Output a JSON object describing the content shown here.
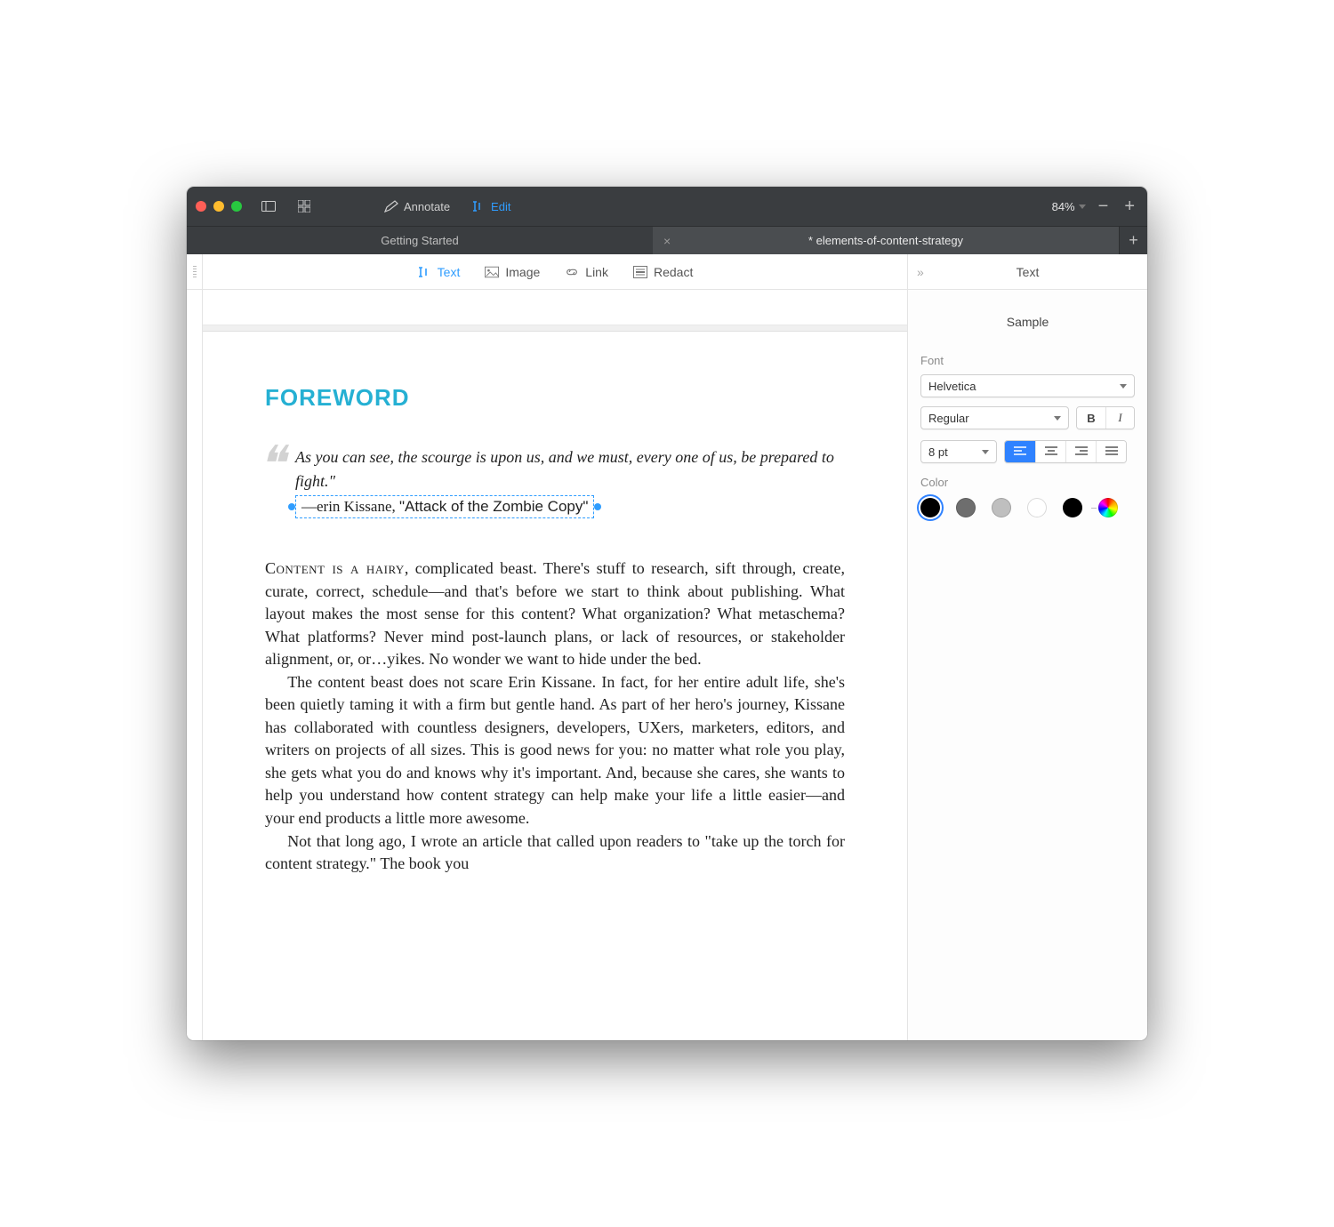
{
  "toolbar": {
    "annotate_label": "Annotate",
    "edit_label": "Edit",
    "zoom": "84%"
  },
  "tabs": [
    {
      "label": "Getting Started",
      "active": false
    },
    {
      "label": "* elements-of-content-strategy",
      "active": true
    }
  ],
  "tools": {
    "text": "Text",
    "image": "Image",
    "link": "Link",
    "redact": "Redact"
  },
  "panel": {
    "title": "Text",
    "sample": "Sample",
    "font_label": "Font",
    "font_family": "Helvetica",
    "font_style": "Regular",
    "font_size": "8 pt",
    "color_label": "Color",
    "colors": [
      "#000000",
      "#6e6e6e",
      "#bfbfbf",
      "#ffffff",
      "#000000"
    ],
    "selected_color_index": 0,
    "alignment": "left"
  },
  "document": {
    "heading": "FOREWORD",
    "quote": "As you can see, the scourge is upon us, and we must, every one of us, be prepared to fight.\"",
    "attribution_name": "—erin Kissane, ",
    "attribution_title": "\"Attack of the Zombie Copy\"",
    "para1_lead": "Content is a hairy",
    "para1_rest": ", complicated beast. There's stuff to research, sift through, create, curate, correct, schedule—and that's before we start to think about publishing. What layout makes the most sense for this content? What organization? What metaschema? What platforms? Never mind post-launch plans, or lack of resources, or stakeholder alignment, or, or…yikes. No wonder we want to hide under the bed.",
    "para2": "The content beast does not scare Erin Kissane. In fact, for her entire adult life, she's been quietly taming it with a firm but gentle hand. As part of her hero's journey, Kissane has collaborated with countless designers, developers, UXers, marketers, editors, and writers on projects of all sizes. This is good news for you: no matter what role you play, she gets what you do and knows why it's important. And, because she cares, she wants to help you understand how content strategy can help make your life a little easier—and your end products a little more awesome.",
    "para3": "Not that long ago, I wrote an article that called upon readers to \"take up the torch for content strategy.\" The book you"
  }
}
